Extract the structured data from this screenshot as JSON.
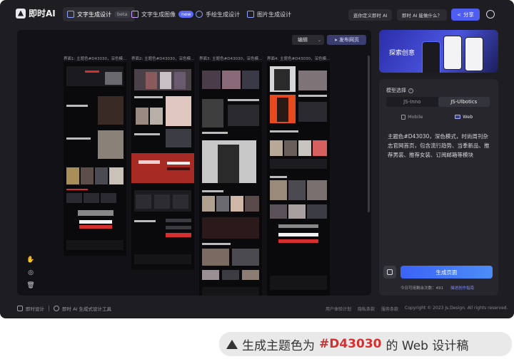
{
  "app": {
    "logo_text": "即时AI",
    "tabs": [
      {
        "label": "文字生成设计",
        "badge": "beta"
      },
      {
        "label": "文字生成图像",
        "badge": "new"
      },
      {
        "label": "手绘生成设计",
        "badge": ""
      },
      {
        "label": "图片生成设计",
        "badge": ""
      }
    ],
    "custom_ai_button": "逛你定义即时 AI",
    "what_ai_button": "即时 AI 能做什么？",
    "share_button": "分享"
  },
  "canvas": {
    "edit_label": "编辑",
    "publish_label": "发布网页",
    "interfaces": [
      {
        "label": "界面1: 主题色#D43030，深色模..."
      },
      {
        "label": "界面2: 主题色#D43030，深色模..."
      },
      {
        "label": "界面3: 主题色#D43030，深色模..."
      },
      {
        "label": "界面4: 主题色#D43030，深色模..."
      }
    ]
  },
  "sidebar": {
    "promo_text": "探索创意",
    "model_label": "模型选择",
    "models": [
      "JS-Inno",
      "JS-Ulbotics"
    ],
    "selected_model": "JS-Ulbotics",
    "devices": [
      "Mobile",
      "Web"
    ],
    "selected_device": "Web",
    "prompt_text": "主题色#D43030，深色模式，时尚周刊杂志官网首页，包含流行趋势、当季新品、推荐男装、推荐女装、订阅邮箱等模块",
    "generate_button": "生成页面",
    "quota_text": "今日可用剩余次数：491",
    "guide_link": "描述创作指南"
  },
  "footer": {
    "left_a": "即时设计",
    "left_b": "即时 AI 生成式设计工具",
    "links": [
      "用户体验计划",
      "隐私条款",
      "服务条款",
      "Copyright © 2023 Js.Design. All rights reserved."
    ]
  },
  "caption": {
    "prefix": "生成主题色为",
    "color": "#D43030",
    "suffix": "的 Web 设计稿"
  },
  "colors": {
    "theme": "#D43030",
    "accent": "#4F5CF0",
    "background": "#1E1E22"
  }
}
